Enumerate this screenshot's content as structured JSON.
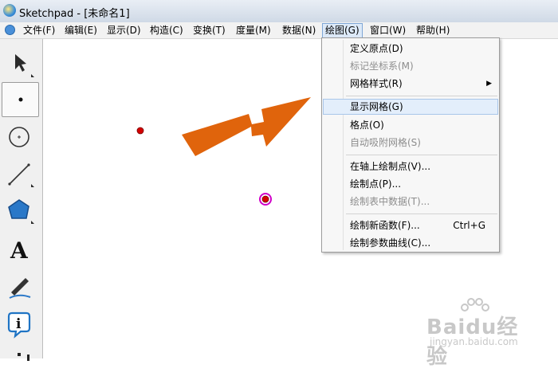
{
  "window": {
    "title": "Sketchpad  - [未命名1]"
  },
  "menubar": {
    "items": [
      {
        "label": "文件(F)"
      },
      {
        "label": "编辑(E)"
      },
      {
        "label": "显示(D)"
      },
      {
        "label": "构造(C)"
      },
      {
        "label": "变换(T)"
      },
      {
        "label": "度量(M)"
      },
      {
        "label": "数据(N)"
      },
      {
        "label": "绘图(G)",
        "active": true
      },
      {
        "label": "窗口(W)"
      },
      {
        "label": "帮助(H)"
      }
    ]
  },
  "toolbox": {
    "tools": [
      {
        "name": "arrow-select-tool"
      },
      {
        "name": "point-tool",
        "selected": true
      },
      {
        "name": "compass-tool"
      },
      {
        "name": "straightedge-tool"
      },
      {
        "name": "polygon-tool"
      },
      {
        "name": "text-tool",
        "glyph": "A"
      },
      {
        "name": "marker-tool"
      },
      {
        "name": "information-tool",
        "glyph": "i"
      },
      {
        "name": "custom-tool"
      }
    ]
  },
  "canvas": {
    "points": [
      {
        "color": "#d40000"
      },
      {
        "color": "#d40000",
        "highlight": "#d000c8"
      }
    ],
    "annotation_arrow_color": "#e0640c"
  },
  "graph_menu": {
    "groups": [
      [
        {
          "label": "定义原点(D)",
          "disabled": false
        },
        {
          "label": "标记坐标系(M)",
          "disabled": true
        },
        {
          "label": "网格样式(R)",
          "disabled": false,
          "submenu": true
        }
      ],
      [
        {
          "label": "显示网格(G)",
          "disabled": false,
          "hover": true
        },
        {
          "label": "格点(O)",
          "disabled": false
        },
        {
          "label": "自动吸附网格(S)",
          "disabled": true
        }
      ],
      [
        {
          "label": "在轴上绘制点(V)...",
          "disabled": false
        },
        {
          "label": "绘制点(P)...",
          "disabled": false
        },
        {
          "label": "绘制表中数据(T)...",
          "disabled": true
        }
      ],
      [
        {
          "label": "绘制新函数(F)...",
          "disabled": false,
          "shortcut": "Ctrl+G"
        },
        {
          "label": "绘制参数曲线(C)...",
          "disabled": false
        }
      ]
    ]
  },
  "watermark": {
    "main": "Baidu经验",
    "sub": "jingyan.baidu.com"
  },
  "colors": {
    "menu_highlight": "#dce9f8",
    "disabled_text": "#8d8d8d"
  }
}
